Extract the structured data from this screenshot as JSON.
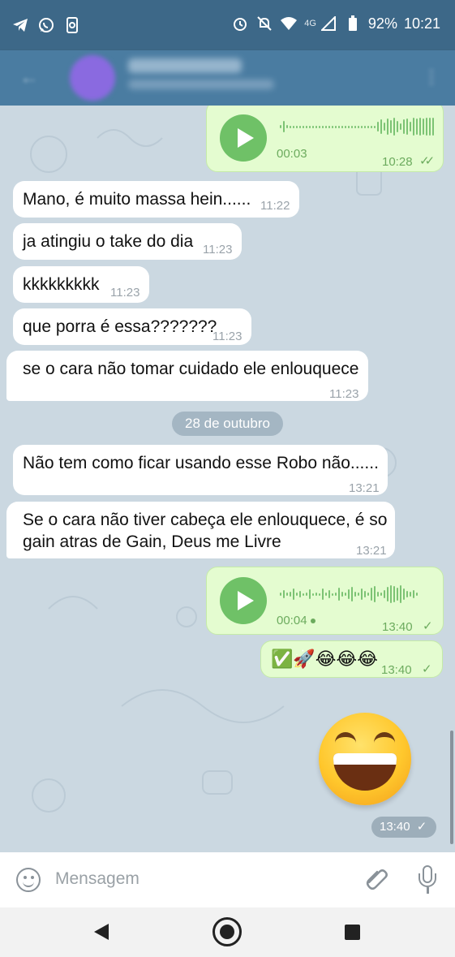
{
  "status_bar": {
    "battery": "92%",
    "time": "10:21",
    "network": "4G",
    "icons": [
      "telegram-icon",
      "whatsapp-icon",
      "phone-link-icon",
      "alarm-icon",
      "mute-icon",
      "wifi-icon",
      "signal-icon",
      "battery-icon"
    ]
  },
  "messages": [
    {
      "type": "voice",
      "direction": "out",
      "duration": "00:03",
      "time": "10:28",
      "status": "read"
    },
    {
      "type": "text",
      "direction": "in",
      "text": "Mano, é muito massa hein......",
      "time": "11:22"
    },
    {
      "type": "text",
      "direction": "in",
      "text": "ja atingiu o take do dia",
      "time": "11:23"
    },
    {
      "type": "text",
      "direction": "in",
      "text": "kkkkkkkkk",
      "time": "11:23"
    },
    {
      "type": "text",
      "direction": "in",
      "text": "que porra é essa???????",
      "time": "11:23"
    },
    {
      "type": "text",
      "direction": "in",
      "text": "se o cara não tomar cuidado ele enlouquece",
      "time": "11:23"
    },
    {
      "type": "date",
      "text": "28 de outubro"
    },
    {
      "type": "text",
      "direction": "in",
      "text": "Não tem como ficar usando esse Robo não......",
      "time": "13:21"
    },
    {
      "type": "text",
      "direction": "in",
      "text_line1": "Se o cara não tiver cabeça ele enlouquece, é so",
      "text_line2": "gain atras de Gain, Deus me Livre",
      "time": "13:21"
    },
    {
      "type": "voice",
      "direction": "out",
      "duration": "00:04",
      "time": "13:40",
      "status": "sent"
    },
    {
      "type": "text",
      "direction": "out",
      "text": "✅🚀😂😂😂",
      "time": "13:40",
      "status": "sent"
    },
    {
      "type": "sticker",
      "direction": "out",
      "emoji": "laughing-face-sticker",
      "time": "13:40",
      "status": "sent"
    }
  ],
  "input": {
    "placeholder": "Mensagem"
  },
  "colors": {
    "header": "#4a7ca1",
    "status_bar": "#3d6888",
    "chat_bg": "#cbd8e1",
    "outgoing_bubble": "#e4fcd0",
    "accent_green": "#6fc167"
  }
}
